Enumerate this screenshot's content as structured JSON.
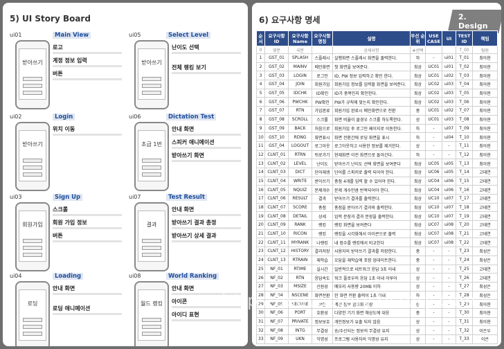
{
  "left": {
    "title": "5)  UI Story Board",
    "cells": [
      {
        "id": "ui01",
        "title": "Main View",
        "screen": "받아쓰기",
        "anns": [
          "로고",
          "계정 정보 입력",
          "버튼"
        ]
      },
      {
        "id": "ui05",
        "title": "Select Level",
        "screen": "받아쓰기",
        "anns": [
          "난이도 선택",
          "전체 랭킹 보기"
        ]
      },
      {
        "id": "ui02",
        "title": "Login",
        "screen": "받아쓰기",
        "anns": [
          "위치 이동"
        ]
      },
      {
        "id": "ui06",
        "title": "Dictation Test",
        "screen": "초급 1번",
        "anns": [
          "안내 화면",
          "스피커 애니메이션",
          "받아쓰기 화면"
        ]
      },
      {
        "id": "ui03",
        "title": "Sign Up",
        "screen": "회원가입",
        "anns": [
          "스크롤",
          "회원 가입 정보",
          "버튼"
        ]
      },
      {
        "id": "ui07",
        "title": "Test Result",
        "screen": "결과",
        "anns": [
          "안내 화면",
          "받아쓰기 결과 총정",
          "받아쓰기 상세 결과"
        ]
      },
      {
        "id": "ui04",
        "title": "Loading",
        "screen": "로딩",
        "anns": [
          "안내 화면",
          "로딩 애니메이션"
        ]
      },
      {
        "id": "ui08",
        "title": "World Ranking",
        "screen": "월드 랭킹",
        "anns": [
          "안내 화면",
          "아이콘",
          "아이디 표현"
        ]
      }
    ]
  },
  "right": {
    "title": "6)  요구사항 명세",
    "tag": "2. Design",
    "headers": [
      "순서",
      "요구사항 ID",
      "요구사항 Name",
      "요구사항 명칭",
      "설명",
      "우선 순위",
      "USE CASE",
      "UI",
      "TEST ID",
      "책임"
    ],
    "subheader": [
      "0",
      "영문",
      "국문",
      "",
      "상세사항",
      "#선택",
      "",
      "",
      "T_00",
      "팀원"
    ],
    "rows": [
      [
        "1",
        "GST_01",
        "SPLASH",
        "스플래시",
        "실행화면 스플래시 화면을 출력한다.",
        "하",
        "-",
        "ui01",
        "T_01",
        "최아현"
      ],
      [
        "2",
        "GST_02",
        "MAINV",
        "메인화면",
        "첫 화면을 보여준다.",
        "최상",
        "UC01",
        "ui01",
        "T_02",
        "최아현"
      ],
      [
        "3",
        "GST_03",
        "LOGIN",
        "로그인",
        "ID, PW 정보 입력하고 확인 한다.",
        "최상",
        "UC01",
        "ui02",
        "T_03",
        "최아현"
      ],
      [
        "4",
        "GST_04",
        "JOIN",
        "회원가입",
        "회원가입 정보를 입력할 화면을 보여준다.",
        "최상",
        "UC02",
        "ui03",
        "T_04",
        "최아현"
      ],
      [
        "5",
        "GST_05",
        "IDCHK",
        "ID확인",
        "ID가 중복인지 확인한다.",
        "최상",
        "UC02",
        "ui03",
        "T_05",
        "최아현"
      ],
      [
        "6",
        "GST_06",
        "PWCHK",
        "PW확인",
        "PW가 규칙에 맞는지 확인한다.",
        "최상",
        "UC02",
        "ui03",
        "T_06",
        "최아현"
      ],
      [
        "7",
        "GST_07",
        "RTN",
        "가입완료",
        "회원가입 완료시 메인화면으로 전환",
        "중",
        "UC01",
        "ui02",
        "T_07",
        "최아현"
      ],
      [
        "8",
        "GST_08",
        "SCROLL",
        "스크롤",
        "화면 비율이 클경우 스크롤 하도록한다.",
        "상",
        "UC01",
        "ui03",
        "T_08",
        "최아현"
      ],
      [
        "9",
        "GST_09",
        "BACK",
        "처음으로",
        "회원가입 후 로그인 페이지로 이동한다.",
        "하",
        "-",
        "ui07",
        "T_09",
        "최아현"
      ],
      [
        "10",
        "GST_10",
        "RDNG",
        "화면표시",
        "화면 전환간에 로딩 화면을 표시",
        "하",
        "-",
        "ui04",
        "T_10",
        "최아현"
      ],
      [
        "11",
        "GST_04",
        "LOGOUT",
        "로그아웃",
        "로그아웃하고 사용한 정보를 제거한다.",
        "상",
        "-",
        "-",
        "T_11",
        "최아현"
      ],
      [
        "12",
        "CLNT_01",
        "RTRN",
        "뒤로가기",
        "현재화면 이전 화면으로 돌아간다.",
        "하",
        "-",
        "-",
        "T_12",
        "최아현"
      ],
      [
        "13",
        "CLNT_02",
        "LEVEL",
        "난이도",
        "받아쓰기 난이도 선택 화면을 보여준다",
        "최상",
        "UC05",
        "ui05",
        "T_13",
        "최아현"
      ],
      [
        "14",
        "CLNT_03",
        "DICT",
        "단어재생",
        "단어를 스피커로 출력 되어야 한다.",
        "최상",
        "UC06",
        "ui05",
        "T_14",
        "고태연"
      ],
      [
        "15",
        "CLNT_04",
        "WRITE",
        "받아쓰기",
        "총점 4개를 입력 할 수 있어야 한다.",
        "최상",
        "UC04",
        "ui06",
        "T_15",
        "고태연"
      ],
      [
        "16",
        "CLNT_05",
        "NQUIZ",
        "문제개수",
        "문제 개수만큼 반복되어야 한다.",
        "최상",
        "UC04",
        "ui06",
        "T_16",
        "고태연"
      ],
      [
        "17",
        "CLNT_06",
        "RESULT",
        "결과",
        "받아쓰기 결과를 출력한다.",
        "최상",
        "UC10",
        "ui07",
        "T_17",
        "고태연"
      ],
      [
        "18",
        "CLNT_07",
        "SCORE",
        "총점",
        "총점을 받아쓰기 결과와 출력한다.",
        "최상",
        "UC10",
        "ui07",
        "T_18",
        "고태연"
      ],
      [
        "19",
        "CLNT_08",
        "DETAIL",
        "상세",
        "입력 문장과 결과 문장을 출력한다.",
        "최상",
        "UC10",
        "ui07",
        "T_19",
        "고태연"
      ],
      [
        "20",
        "CLNT_09",
        "RANK",
        "랭킹",
        "랭킹 화면을 보여준다",
        "최상",
        "UC07",
        "ui08",
        "T_20",
        "고태연"
      ],
      [
        "21",
        "CLNT_10",
        "RICON",
        "랭킹",
        "랭킹을 시각화해서 아이콘으로 출력",
        "최상",
        "UC07",
        "ui08",
        "T_21",
        "고태연"
      ],
      [
        "22",
        "CLNT_11",
        "MYRANK",
        "나랭킹",
        "내 점수를 랭킹에서 비교한다",
        "최상",
        "UC07",
        "ui08",
        "T_22",
        "고태연"
      ],
      [
        "23",
        "CLNT_12",
        "HISTORY",
        "결과저장",
        "사용자의 받아쓰기 결과를 저장한다.",
        "중",
        "-",
        "-",
        "T_23",
        "최성은"
      ],
      [
        "24",
        "CLNT_13",
        "RTRAIN",
        "재학습",
        "오답을 재학습에 포함 업데이트한다.",
        "중",
        "-",
        "-",
        "T_24",
        "최성은"
      ],
      [
        "25",
        "NF_01",
        "RTIME",
        "실시간",
        "일반적으로 네트워크 응답 3초 이내",
        "상",
        "-",
        "-",
        "T_25",
        "고태연"
      ],
      [
        "26",
        "NF_02",
        "RTN",
        "응답속도",
        "워크 플로우의 응답 1초 이내 이루어",
        "상",
        "-",
        "-",
        "T_26",
        "고태연"
      ],
      [
        "27",
        "NF_03",
        "MSIZE",
        "신원성",
        "메모리 사용량 20MB 이하",
        "상",
        "-",
        "-",
        "T_27",
        "최성은"
      ],
      [
        "28",
        "NF_04",
        "NSCENE",
        "화면전환",
        "한 화면 전환 출력이 1초 이내",
        "하",
        "-",
        "-",
        "T_28",
        "최성은"
      ],
      [
        "29",
        "NF_05",
        "SECURE",
        "보안",
        "계정 정보 암호화 저장",
        "상",
        "-",
        "-",
        "T_29",
        "최아현"
      ],
      [
        "30",
        "NF_06",
        "PORT",
        "호환성",
        "다양한 기기 화면 해상도에 대응",
        "중",
        "-",
        "-",
        "T_30",
        "최아현"
      ],
      [
        "31",
        "NF_07",
        "PRIVATE",
        "정보보호",
        "개인정보가 유출 되지 않음",
        "상",
        "-",
        "-",
        "T_31",
        "최아현"
      ],
      [
        "32",
        "NF_08",
        "INTG",
        "무결성",
        "송/수신되는 정보의 무결성 유지",
        "상",
        "-",
        "-",
        "T_32",
        "이은우"
      ],
      [
        "33",
        "NF_09",
        "UKN",
        "익명성",
        "프로그램 사용자의 익명성 유지",
        "상",
        "-",
        "-",
        "T_33",
        "이은"
      ]
    ]
  },
  "watermark": "https://sucastory.tistory.com"
}
